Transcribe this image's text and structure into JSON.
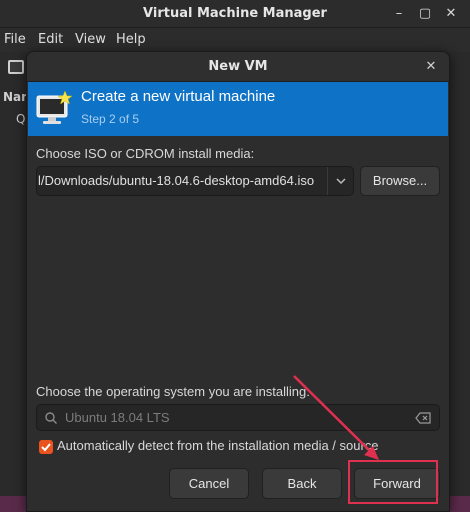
{
  "app": {
    "window_title": "Virtual Machine Manager",
    "menu": [
      "File",
      "Edit",
      "View",
      "Help"
    ],
    "bg_column_header": "Nar",
    "bg_row_text": "Q"
  },
  "dialog": {
    "title": "New VM",
    "banner_title": "Create a new virtual machine",
    "banner_step": "Step 2 of 5",
    "iso_label": "Choose ISO or CDROM install media:",
    "iso_value": "l/Downloads/ubuntu-18.04.6-desktop-amd64.iso",
    "browse_label": "Browse...",
    "os_label": "Choose the operating system you are installing:",
    "os_search_placeholder": "Ubuntu 18.04 LTS",
    "auto_detect_label": "Automatically detect from the installation media / source",
    "auto_detect_checked": true,
    "buttons": {
      "cancel": "Cancel",
      "back": "Back",
      "forward": "Forward"
    }
  },
  "colors": {
    "banner": "#0e72c6",
    "checkbox": "#e9541e",
    "highlight": "#e03050"
  },
  "icons": {
    "window_min": "minimize-icon",
    "window_max": "maximize-icon",
    "window_close": "close-icon",
    "banner": "new-vm-monitor-icon",
    "combo_arrow": "chevron-down-icon",
    "search": "search-icon",
    "clear": "clear-text-icon"
  }
}
